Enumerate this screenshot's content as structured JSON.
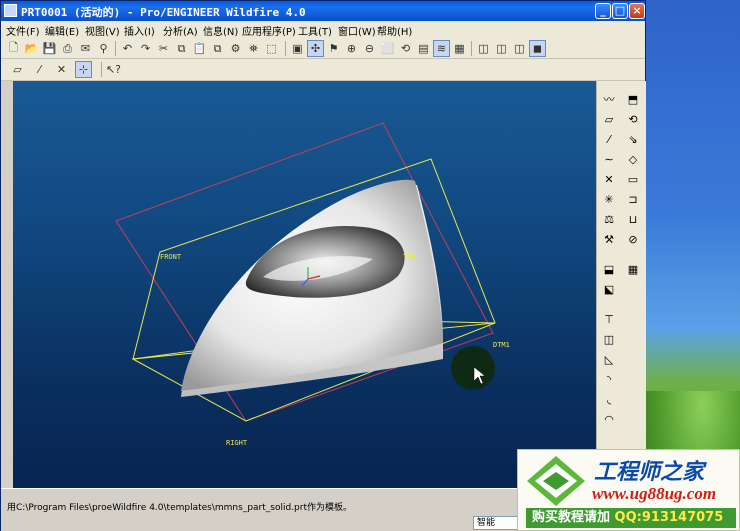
{
  "window": {
    "title": "PRT0001 (活动的) - Pro/ENGINEER Wildfire 4.0",
    "minimize": "_",
    "maximize": "□",
    "close": "×"
  },
  "menu": [
    "文件(F)",
    "编辑(E)",
    "视图(V)",
    "插入(I)",
    "分析(A)",
    "信息(N)",
    "应用程序(P)",
    "工具(T)",
    "窗口(W)",
    "帮助(H)"
  ],
  "toolbar1_icons": [
    "new-file-icon",
    "open-folder-icon",
    "save-icon",
    "print-icon",
    "email-icon",
    "email-link-icon",
    "undo-icon",
    "redo-icon",
    "cut-icon",
    "copy-icon",
    "paste-icon",
    "paste-special-icon",
    "regenerate-icon",
    "find-icon",
    "select-box-icon",
    "refit-icon",
    "spin-center-icon",
    "view-manager-icon",
    "zoom-in-icon",
    "zoom-out-icon",
    "refit-view-icon",
    "reorient-icon",
    "saved-views-icon",
    "layers-icon",
    "appearance-icon",
    "wireframe-icon",
    "hidden-line-icon",
    "no-hidden-icon",
    "shading-icon"
  ],
  "toolbar2_icons": [
    "datum-planes-icon",
    "datum-axes-icon",
    "datum-points-icon",
    "coordinate-systems-icon",
    "whats-this-icon"
  ],
  "model": {
    "datum_labels": [
      "FRONT",
      "TOP",
      "DTM1",
      "RIGHT"
    ]
  },
  "status": {
    "message": "用C:\\Program Files\\proeWildfire 4.0\\templates\\mmns_part_solid.prt作为模板。",
    "filter_value": "智能"
  },
  "watermark": {
    "name": "工程师之家",
    "url": "www.ug88ug.com",
    "promo": "购买教程请加",
    "qq": "QQ:913147075"
  },
  "colors": {
    "viewport_top": "#1a5a95",
    "viewport_bottom": "#082450",
    "datum_plane_yellow": "#e8e84a",
    "datum_plane_red": "#c0405a"
  }
}
